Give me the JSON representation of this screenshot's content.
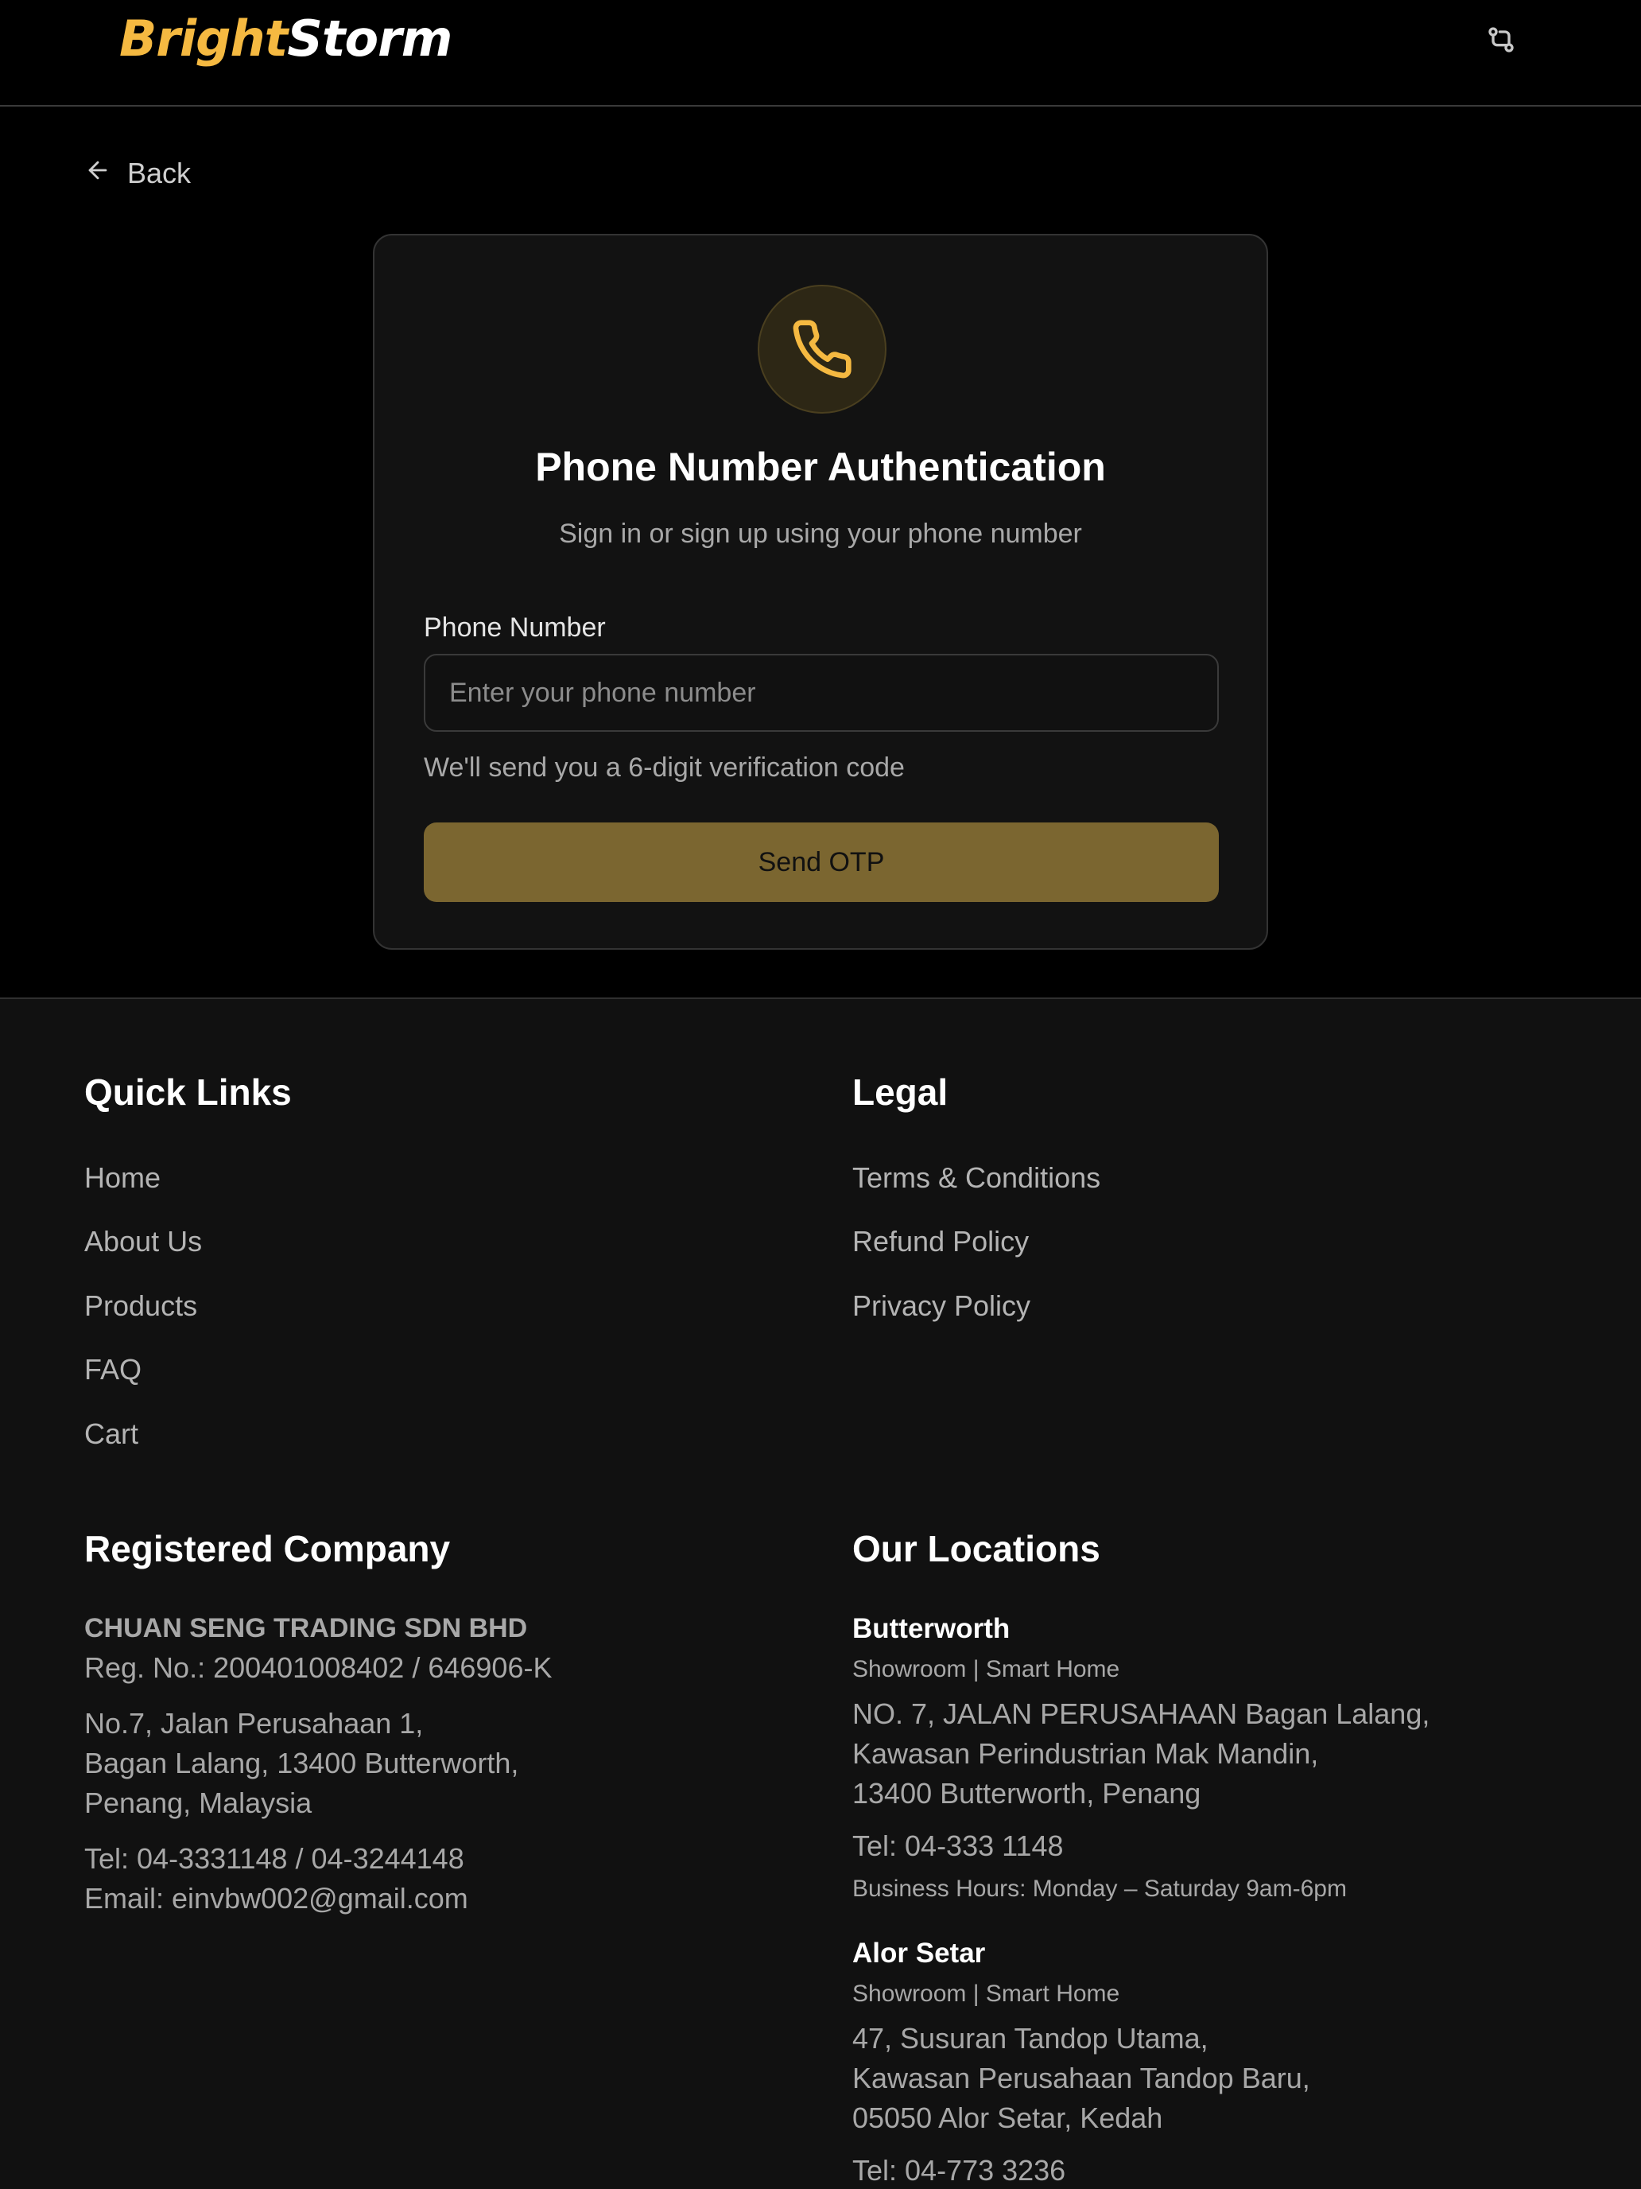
{
  "header": {
    "logo_bright": "Bright",
    "logo_storm": "Storm",
    "theme_toggle_icon": "route-icon"
  },
  "back": {
    "label": "Back",
    "icon": "arrow-left-icon"
  },
  "auth_card": {
    "icon": "phone-icon",
    "title": "Phone Number Authentication",
    "subtitle": "Sign in or sign up using your phone number",
    "phone_label": "Phone Number",
    "phone_value": "",
    "phone_placeholder": "Enter your phone number",
    "hint": "We'll send you a 6-digit verification code",
    "submit_label": "Send OTP"
  },
  "footer": {
    "quick_links": {
      "title": "Quick Links",
      "items": [
        "Home",
        "About Us",
        "Products",
        "FAQ",
        "Cart"
      ]
    },
    "legal": {
      "title": "Legal",
      "items": [
        "Terms & Conditions",
        "Refund Policy",
        "Privacy Policy"
      ]
    },
    "company": {
      "title": "Registered Company",
      "name": "CHUAN SENG TRADING SDN BHD",
      "reg_no": "Reg. No.: 200401008402 / 646906-K",
      "address": [
        "No.7, Jalan Perusahaan 1,",
        "Bagan Lalang, 13400 Butterworth,",
        "Penang, Malaysia"
      ],
      "tel": "Tel: 04-3331148 / 04-3244148",
      "email": "Email: einvbw002@gmail.com"
    },
    "locations": {
      "title": "Our Locations",
      "items": [
        {
          "name": "Butterworth",
          "type": "Showroom | Smart Home",
          "address": [
            "NO. 7, JALAN PERUSAHAAN Bagan Lalang,",
            "Kawasan Perindustrian Mak Mandin,",
            "13400 Butterworth, Penang"
          ],
          "tel": "Tel: 04-333 1148",
          "hours": "Business Hours: Monday – Saturday 9am-6pm"
        },
        {
          "name": "Alor Setar",
          "type": "Showroom | Smart Home",
          "address": [
            "47, Susuran Tandop Utama,",
            "Kawasan Perusahaan Tandop Baru,",
            "05050 Alor Setar, Kedah"
          ],
          "tel": "Tel: 04-773 3236"
        }
      ]
    }
  },
  "colors": {
    "accent": "#f5b941",
    "button": "#7b6630",
    "background": "#000000",
    "footer_bg": "#111111",
    "card_bg": "#121212"
  }
}
